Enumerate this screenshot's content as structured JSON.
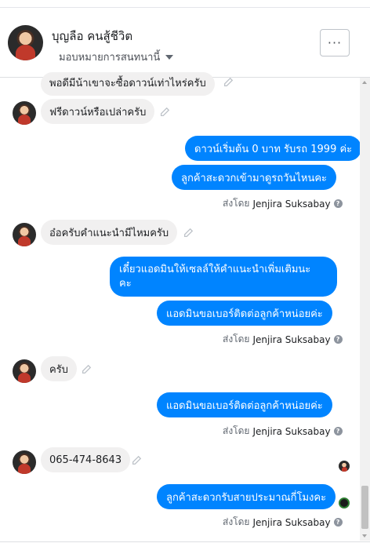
{
  "header": {
    "contact_name": "บุญลือ คนสู้ชีวิต",
    "assign_label": "มอบหมายการสนทนานี้",
    "more_label": "···"
  },
  "messages": {
    "m0_text": "พอดีมีน้าเขาจะซื้อดาวน์เท่าไหร่ครับ",
    "m1_text": "ฟรีดาวน์หรือเปล่าครับ",
    "m2_text": "ดาวน์เริ่มต้น 0 บาท รับรถ 1999 ค่ะ",
    "m3_text": "ลูกค้าสะดวกเข้ามาดูรถวันไหนคะ",
    "m4_text": "อ๋อครับคำแนะนำมีไหมครับ",
    "m5_line1": "เดี๋ยวแอดมินให้เซลล์ให้คำแนะนำเพิ่มเติมนะ",
    "m5_line2": "คะ",
    "m6_text": "แอดมินขอเบอร์ติดต่อลูกค้าหน่อยค่ะ",
    "m7_text": "ครับ",
    "m8_text": "แอดมินขอเบอร์ติดต่อลูกค้าหน่อยค่ะ",
    "m9_text": "065-474-8643",
    "m10_text": "ลูกค้าสะดวกรับสายประมาณกี่โมงคะ"
  },
  "sent_by": {
    "prefix": "ส่งโดย",
    "agent": "Jenjira Suksabay",
    "info_icon": "?"
  },
  "colors": {
    "outgoing_bubble": "#0084ff",
    "incoming_bubble": "#f1f0f0"
  },
  "icons": {
    "edit": "pencil-icon",
    "info": "question-circle-icon",
    "dropdown": "caret-down-icon"
  }
}
